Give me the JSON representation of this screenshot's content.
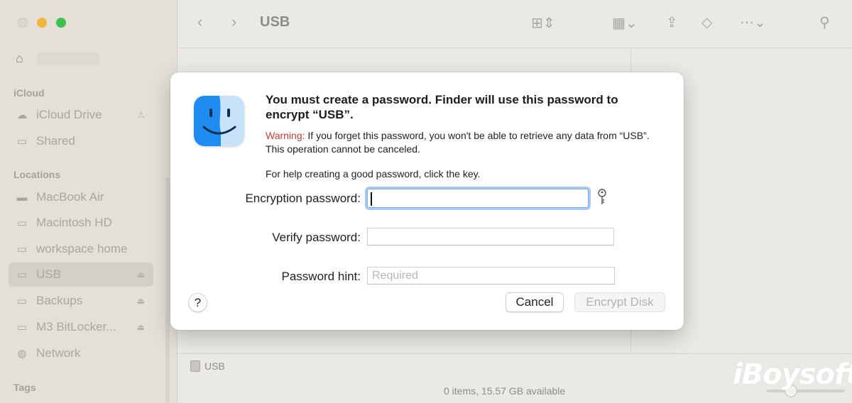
{
  "window": {
    "title": "USB"
  },
  "sidebar": {
    "sections": {
      "icloud": "iCloud",
      "locations": "Locations",
      "tags": "Tags"
    },
    "icloud_items": [
      {
        "label": "iCloud Drive",
        "icon": "cloud-icon"
      },
      {
        "label": "Shared",
        "icon": "shared-folder-icon"
      }
    ],
    "location_items": [
      {
        "label": "MacBook Air",
        "icon": "laptop-icon"
      },
      {
        "label": "Macintosh HD",
        "icon": "drive-icon"
      },
      {
        "label": "workspace home",
        "icon": "network-drive-icon"
      },
      {
        "label": "USB",
        "icon": "external-drive-icon",
        "selected": true
      },
      {
        "label": "Backups",
        "icon": "external-drive-icon"
      },
      {
        "label": "M3 BitLocker...",
        "icon": "external-drive-icon"
      },
      {
        "label": "Network",
        "icon": "globe-icon"
      }
    ]
  },
  "pathbar": {
    "item": "USB"
  },
  "statusbar": {
    "text": "0 items, 15.57 GB available"
  },
  "watermark": "iBoysoft",
  "dialog": {
    "headline": "You must create a password. Finder will use this password to encrypt “USB”.",
    "warning_label": "Warning:",
    "warning_text": " If you forget this password, you won't be able to retrieve any data from “USB”. This operation cannot be canceled.",
    "help_text": "For help creating a good password, click the key.",
    "encryption_password_label": "Encryption password:",
    "encryption_password_value": "",
    "verify_password_label": "Verify password:",
    "verify_password_value": "",
    "password_hint_label": "Password hint:",
    "password_hint_placeholder": "Required",
    "help_button": "?",
    "cancel_button": "Cancel",
    "encrypt_button": "Encrypt Disk",
    "encrypt_enabled": false
  },
  "colors": {
    "warning": "#d23a30",
    "focus_ring": "#a9c9f1",
    "finder_blue": "#1e8cf0"
  }
}
